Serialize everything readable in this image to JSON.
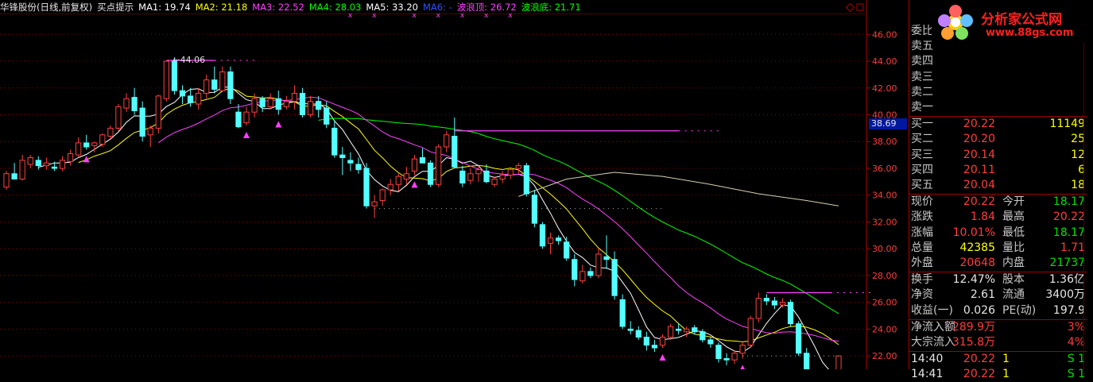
{
  "header": {
    "stock": "华锋股份(日线,前复权)",
    "indicator": "买点提示",
    "ma1": "MA1: 19.74",
    "ma2": "MA2: 21.18",
    "ma3": "MA3: 22.52",
    "ma4": "MA4: 28.03",
    "ma5": "MA5: 33.20",
    "ma6": "MA6: -",
    "wave_top": "波浪顶: 26.72",
    "wave_bottom": "波浪底: 21.71",
    "colors": {
      "ma1": "#ffffff",
      "ma2": "#ffff00",
      "ma3": "#ff40ff",
      "ma4": "#00ff00",
      "ma5": "#ffffff",
      "ma6": "#0000ff",
      "wave_top": "#ff40ff",
      "wave_bottom": "#00ff00"
    }
  },
  "logo": {
    "name": "分析家公式网",
    "url": "www.88gs.com"
  },
  "price_marker": "38.69",
  "chart_data": {
    "type": "candlestick",
    "ylim": [
      21.0,
      47.5
    ],
    "yticks": [
      "22.00",
      "24.00",
      "26.00",
      "28.00",
      "30.00",
      "32.00",
      "34.00",
      "36.00",
      "38.00",
      "40.00",
      "42.00",
      "44.00",
      "46.00"
    ],
    "high_annotation": "44.06",
    "candles": [
      [
        34.6,
        35.8,
        34.4,
        35.6
      ],
      [
        35.6,
        36.4,
        35.3,
        35.2
      ],
      [
        35.2,
        37.0,
        35.1,
        36.6
      ],
      [
        36.3,
        37.0,
        36.0,
        36.8
      ],
      [
        36.6,
        36.9,
        35.9,
        36.2
      ],
      [
        36.2,
        36.8,
        35.9,
        36.4
      ],
      [
        36.1,
        36.5,
        35.8,
        36.0
      ],
      [
        36.0,
        36.9,
        35.8,
        36.6
      ],
      [
        36.5,
        37.4,
        36.2,
        37.1
      ],
      [
        37.0,
        38.3,
        36.8,
        37.9
      ],
      [
        37.9,
        38.5,
        37.4,
        37.6
      ],
      [
        37.7,
        38.0,
        37.2,
        37.9
      ],
      [
        37.8,
        38.6,
        37.6,
        38.5
      ],
      [
        38.4,
        39.2,
        38.2,
        39.0
      ],
      [
        39.0,
        40.8,
        38.8,
        40.6
      ],
      [
        40.5,
        41.6,
        40.2,
        41.2
      ],
      [
        41.3,
        42.0,
        40.0,
        40.3
      ],
      [
        40.5,
        41.0,
        38.0,
        38.4
      ],
      [
        38.5,
        39.2,
        37.6,
        39.0
      ],
      [
        39.0,
        41.5,
        38.6,
        41.4
      ],
      [
        41.2,
        44.06,
        41.0,
        44.0
      ],
      [
        44.0,
        44.3,
        41.5,
        41.8
      ],
      [
        41.8,
        42.2,
        40.8,
        41.4
      ],
      [
        41.4,
        42.0,
        40.6,
        40.9
      ],
      [
        40.8,
        42.0,
        40.4,
        41.6
      ],
      [
        41.6,
        43.0,
        41.2,
        42.6
      ],
      [
        42.6,
        43.6,
        41.6,
        41.9
      ],
      [
        41.8,
        43.6,
        41.7,
        43.2
      ],
      [
        43.2,
        43.6,
        40.8,
        41.2
      ],
      [
        40.2,
        40.8,
        39.0,
        39.1
      ],
      [
        39.4,
        40.6,
        39.2,
        40.2
      ],
      [
        40.2,
        41.6,
        39.8,
        41.2
      ],
      [
        41.2,
        41.4,
        40.2,
        40.6
      ],
      [
        40.6,
        41.6,
        40.4,
        41.2
      ],
      [
        41.2,
        41.8,
        40.0,
        40.4
      ],
      [
        40.6,
        41.4,
        40.4,
        41.0
      ],
      [
        41.0,
        42.2,
        40.4,
        41.6
      ],
      [
        41.6,
        42.0,
        39.8,
        40.0
      ],
      [
        40.0,
        41.4,
        39.8,
        41.0
      ],
      [
        41.0,
        41.4,
        39.8,
        40.4
      ],
      [
        40.5,
        41.0,
        39.0,
        39.3
      ],
      [
        39.0,
        39.6,
        36.8,
        37.0
      ],
      [
        37.0,
        37.6,
        35.5,
        36.8
      ],
      [
        36.6,
        37.2,
        35.8,
        36.4
      ],
      [
        36.3,
        36.8,
        35.6,
        35.9
      ],
      [
        36.0,
        36.4,
        33.0,
        33.2
      ],
      [
        33.2,
        34.0,
        32.3,
        33.5
      ],
      [
        33.6,
        34.5,
        33.2,
        34.4
      ],
      [
        34.4,
        35.2,
        34.0,
        34.8
      ],
      [
        34.8,
        35.6,
        34.3,
        35.4
      ],
      [
        35.2,
        36.1,
        34.8,
        35.6
      ],
      [
        35.8,
        37.0,
        35.5,
        36.7
      ],
      [
        36.8,
        37.5,
        36.4,
        36.4
      ],
      [
        36.4,
        36.6,
        34.6,
        34.8
      ],
      [
        34.8,
        37.8,
        34.6,
        37.6
      ],
      [
        37.6,
        38.8,
        37.2,
        38.5
      ],
      [
        38.4,
        39.8,
        36.0,
        36.1
      ],
      [
        35.8,
        36.2,
        34.6,
        34.9
      ],
      [
        35.1,
        36.0,
        34.8,
        35.6
      ],
      [
        35.6,
        36.2,
        35.0,
        35.9
      ],
      [
        35.8,
        36.3,
        34.9,
        35.0
      ],
      [
        34.8,
        35.4,
        34.6,
        35.2
      ],
      [
        35.2,
        35.8,
        34.9,
        35.5
      ],
      [
        35.5,
        36.0,
        35.2,
        35.9
      ],
      [
        36.0,
        36.4,
        35.6,
        36.2
      ],
      [
        36.2,
        36.4,
        33.9,
        34.1
      ],
      [
        34.0,
        34.4,
        31.6,
        31.9
      ],
      [
        31.8,
        32.0,
        30.0,
        30.2
      ],
      [
        30.4,
        31.2,
        29.6,
        30.8
      ],
      [
        30.8,
        31.0,
        30.3,
        30.6
      ],
      [
        30.5,
        30.9,
        29.1,
        29.3
      ],
      [
        29.2,
        29.6,
        27.2,
        27.7
      ],
      [
        27.6,
        28.8,
        27.4,
        28.3
      ],
      [
        28.3,
        28.6,
        27.8,
        28.0
      ],
      [
        28.0,
        30.0,
        27.8,
        29.6
      ],
      [
        29.4,
        31.0,
        28.5,
        29.2
      ],
      [
        29.2,
        29.8,
        26.2,
        26.5
      ],
      [
        26.2,
        26.6,
        24.0,
        24.2
      ],
      [
        24.0,
        24.6,
        23.6,
        23.9
      ],
      [
        23.9,
        24.2,
        23.2,
        23.4
      ],
      [
        23.4,
        23.8,
        22.4,
        22.8
      ],
      [
        22.8,
        23.2,
        22.3,
        22.6
      ],
      [
        22.8,
        23.6,
        22.6,
        23.4
      ],
      [
        23.4,
        24.4,
        23.2,
        24.2
      ],
      [
        24.0,
        24.4,
        23.6,
        23.9
      ],
      [
        23.8,
        24.2,
        23.4,
        24.0
      ],
      [
        24.1,
        24.3,
        23.6,
        23.8
      ],
      [
        23.8,
        24.0,
        23.0,
        23.2
      ],
      [
        23.2,
        23.4,
        22.6,
        22.9
      ],
      [
        22.8,
        23.0,
        21.5,
        21.8
      ],
      [
        21.8,
        22.2,
        21.3,
        21.7
      ],
      [
        21.7,
        22.4,
        21.4,
        22.2
      ],
      [
        22.2,
        23.0,
        21.8,
        22.8
      ],
      [
        22.8,
        25.0,
        22.6,
        24.8
      ],
      [
        24.8,
        26.72,
        24.5,
        26.3
      ],
      [
        26.3,
        26.6,
        25.8,
        26.1
      ],
      [
        26.1,
        26.4,
        25.5,
        25.8
      ],
      [
        25.8,
        26.3,
        25.6,
        26.0
      ],
      [
        26.0,
        26.2,
        24.2,
        24.4
      ],
      [
        24.4,
        24.6,
        22.0,
        22.2
      ],
      [
        22.2,
        22.6,
        20.5,
        20.8
      ],
      [
        20.6,
        21.0,
        20.0,
        20.2
      ],
      [
        20.2,
        20.8,
        19.8,
        20.0
      ],
      [
        20.0,
        21.0,
        19.9,
        20.9
      ],
      [
        20.9,
        22.0,
        20.6,
        22.0
      ]
    ],
    "buy_signals": [
      10,
      30,
      34,
      51,
      82,
      92
    ],
    "top_lines": [
      {
        "from": 20,
        "to": 26,
        "y": 44.06
      },
      {
        "from": 56,
        "to": 84,
        "y": 38.8
      },
      {
        "from": 95,
        "to": 103,
        "y": 26.72
      }
    ]
  },
  "quote_panel": {
    "rows_top": [
      "委比",
      "卖五",
      "卖四",
      "卖三",
      "卖二",
      "卖一"
    ],
    "bids": [
      {
        "label": "买一",
        "price": "20.22",
        "vol": "11149"
      },
      {
        "label": "买二",
        "price": "20.20",
        "vol": "25"
      },
      {
        "label": "买三",
        "price": "20.14",
        "vol": "12"
      },
      {
        "label": "买四",
        "price": "20.11",
        "vol": "6"
      },
      {
        "label": "买五",
        "price": "20.04",
        "vol": "18"
      }
    ],
    "stats": [
      {
        "l1": "现价",
        "v1": "20.22",
        "c1": "red",
        "l2": "今开",
        "v2": "18.17",
        "c2": "green"
      },
      {
        "l1": "涨跌",
        "v1": "1.84",
        "c1": "red",
        "l2": "最高",
        "v2": "20.22",
        "c2": "red"
      },
      {
        "l1": "涨幅",
        "v1": "10.01%",
        "c1": "red",
        "l2": "最低",
        "v2": "18.17",
        "c2": "green"
      },
      {
        "l1": "总量",
        "v1": "42385",
        "c1": "yellow",
        "l2": "量比",
        "v2": "1.71",
        "c2": "red"
      },
      {
        "l1": "外盘",
        "v1": "20648",
        "c1": "red",
        "l2": "内盘",
        "v2": "21737",
        "c2": "green"
      }
    ],
    "fund": [
      {
        "l1": "换手",
        "v1": "12.47%",
        "l2": "股本",
        "v2": "1.36亿"
      },
      {
        "l1": "净资",
        "v1": "2.61",
        "l2": "流通",
        "v2": "3400万"
      },
      {
        "l1": "收益(一)",
        "v1": "0.026",
        "l2": "PE(动)",
        "v2": "197.9"
      }
    ],
    "flow": [
      {
        "l": "净流入额",
        "v": "289.9万",
        "p": "3%"
      },
      {
        "l": "大宗流入",
        "v": "315.8万",
        "p": "4%"
      }
    ],
    "ticks": [
      {
        "time": "14:40",
        "price": "20.22",
        "vol": "1",
        "side": "S",
        "n": "1"
      },
      {
        "time": "14:41",
        "price": "20.22",
        "vol": "1",
        "side": "S",
        "n": "1"
      }
    ]
  }
}
